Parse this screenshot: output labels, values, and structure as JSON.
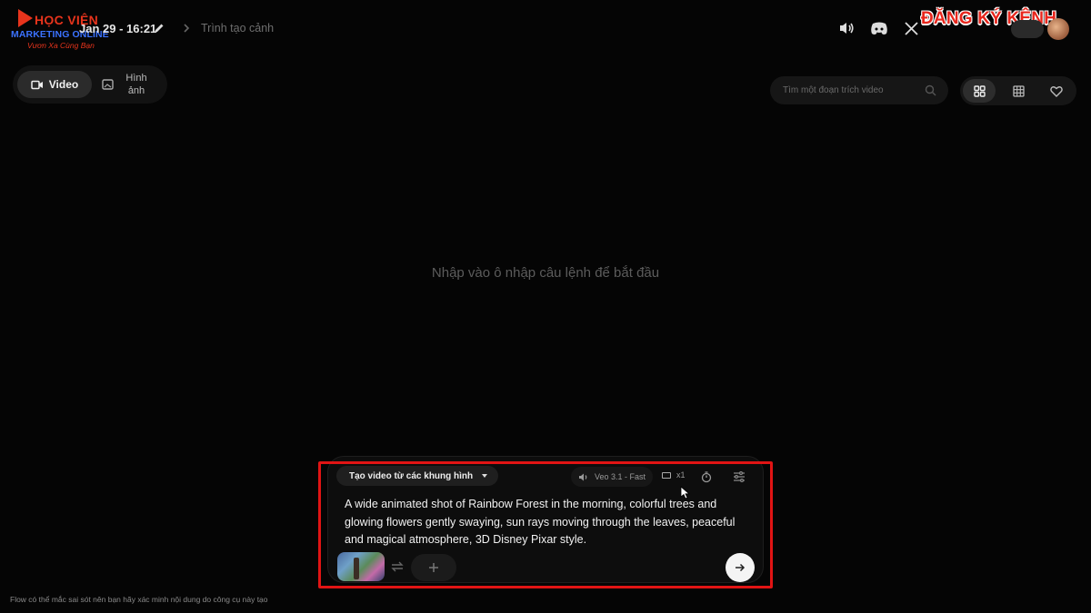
{
  "branding": {
    "line1": "HỌC VIỆN",
    "line2": "MARKETING ONLINE",
    "line3": "Vươn Xa Cùng Bạn",
    "subscribe": "ĐĂNG KÝ KÊNH"
  },
  "header": {
    "date": "Jan 29 - 16:21",
    "breadcrumb": "Trình tạo cảnh"
  },
  "modes": {
    "video_label": "Video",
    "image_label": "Hình ảnh"
  },
  "search": {
    "placeholder": "Tìm một đoạn trích video"
  },
  "main": {
    "empty_message": "Nhập vào ô nhập câu lệnh để bắt đầu"
  },
  "composer": {
    "mode_label": "Tạo video từ các khung hình",
    "model_label": "Veo 3.1 - Fast",
    "count_label": "x1",
    "prompt": "A wide animated shot of Rainbow Forest in the morning, colorful trees and glowing flowers gently swaying, sun rays moving through the leaves, peaceful and magical atmosphere, 3D Disney Pixar style."
  },
  "footer": {
    "disclaimer": "Flow có thể mắc sai sót nên bạn hãy xác minh nội dung do công cụ này tạo"
  },
  "colors": {
    "highlight": "#e11414",
    "brand_red": "#e8341c",
    "brand_blue": "#3b72ff"
  },
  "icons": [
    "pencil-icon",
    "chevron-right-icon",
    "speaker-icon",
    "discord-icon",
    "x-icon",
    "video-icon",
    "image-icon",
    "search-icon",
    "grid-large-icon",
    "grid-small-icon",
    "heart-icon",
    "timer-icon",
    "tune-icon",
    "swap-icon",
    "plus-icon",
    "arrow-right-icon"
  ]
}
